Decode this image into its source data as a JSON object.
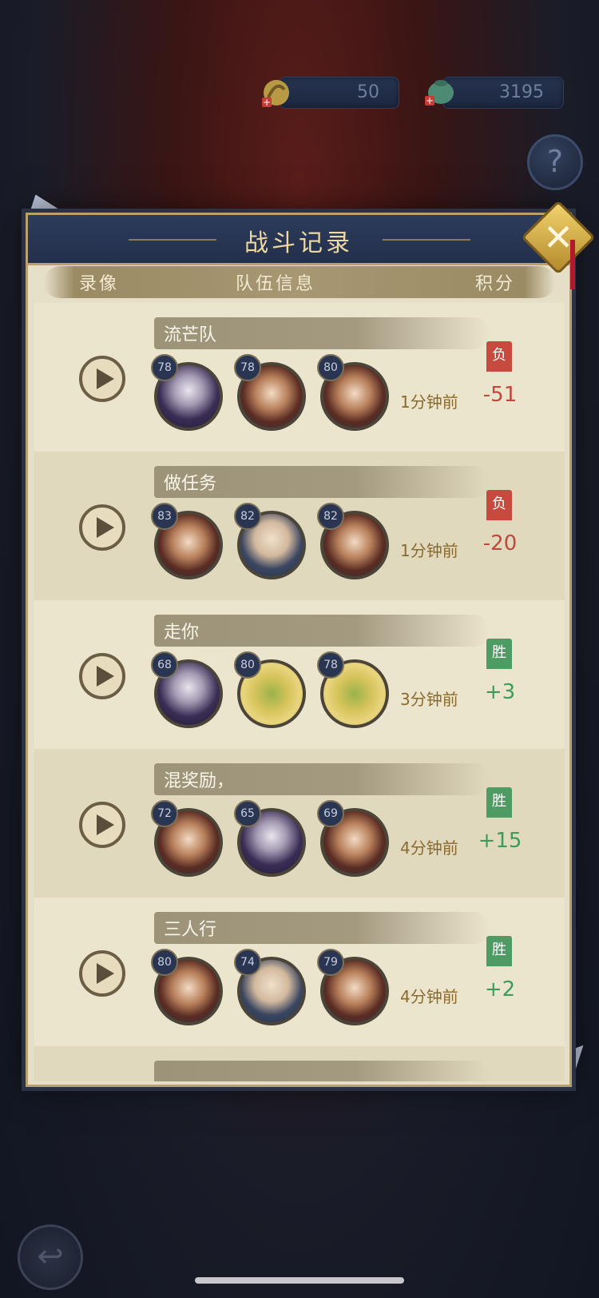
{
  "resources": [
    {
      "icon": "dragon-coin-icon",
      "value": "50"
    },
    {
      "icon": "jade-bag-icon",
      "value": "3195"
    }
  ],
  "help": {
    "label": "?"
  },
  "panel": {
    "title": "战斗记录",
    "close_label": "✕",
    "columns": {
      "replay": "录像",
      "team": "队伍信息",
      "score": "积分"
    }
  },
  "records": [
    {
      "team": "流芒队",
      "levels": [
        "78",
        "78",
        "80"
      ],
      "time": "1分钟前",
      "result": "负",
      "score": "-51",
      "outcome": "lose"
    },
    {
      "team": "做任务",
      "levels": [
        "83",
        "82",
        "82"
      ],
      "time": "1分钟前",
      "result": "负",
      "score": "-20",
      "outcome": "lose"
    },
    {
      "team": "走你",
      "levels": [
        "68",
        "80",
        "78"
      ],
      "time": "3分钟前",
      "result": "胜",
      "score": "+3",
      "outcome": "win"
    },
    {
      "team": "混奖励，",
      "levels": [
        "72",
        "65",
        "69"
      ],
      "time": "4分钟前",
      "result": "胜",
      "score": "+15",
      "outcome": "win"
    },
    {
      "team": "三人行",
      "levels": [
        "80",
        "74",
        "79"
      ],
      "time": "4分钟前",
      "result": "胜",
      "score": "+2",
      "outcome": "win"
    }
  ],
  "back": {
    "label": "↩"
  }
}
